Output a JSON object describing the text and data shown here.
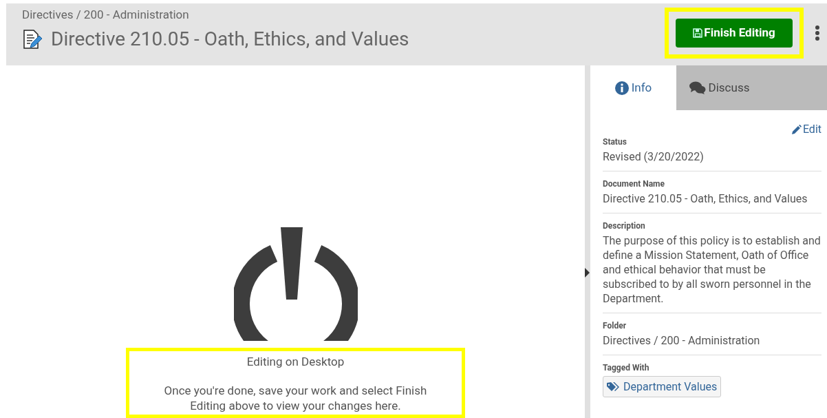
{
  "header": {
    "breadcrumb": "Directives / 200 - Administration",
    "title": "Directive 210.05 - Oath, Ethics, and Values",
    "finish_button": "Finish Editing",
    "highlighted": true
  },
  "editor": {
    "heading": "Editing on Desktop",
    "message": "Once you're done, save your work and select Finish Editing above to view your changes here.",
    "highlighted": true
  },
  "tabs": [
    {
      "label": "Info",
      "kind": "info",
      "selected": true
    },
    {
      "label": "Discuss",
      "kind": "discuss",
      "selected": false
    }
  ],
  "edit_link": "Edit",
  "fields": [
    {
      "label": "Status",
      "value": "Revised (3/20/2022)"
    },
    {
      "label": "Document Name",
      "value": "Directive 210.05 - Oath, Ethics, and Values"
    },
    {
      "label": "Description",
      "value": "The purpose of this policy is to establish and define a Mission Statement, Oath of Office and ethical behavior that must be subscribed to by all sworn personnel in the Department."
    },
    {
      "label": "Folder",
      "value": "Directives / 200 - Administration"
    }
  ],
  "tags": {
    "label": "Tagged With",
    "items": [
      "Department Values"
    ]
  }
}
